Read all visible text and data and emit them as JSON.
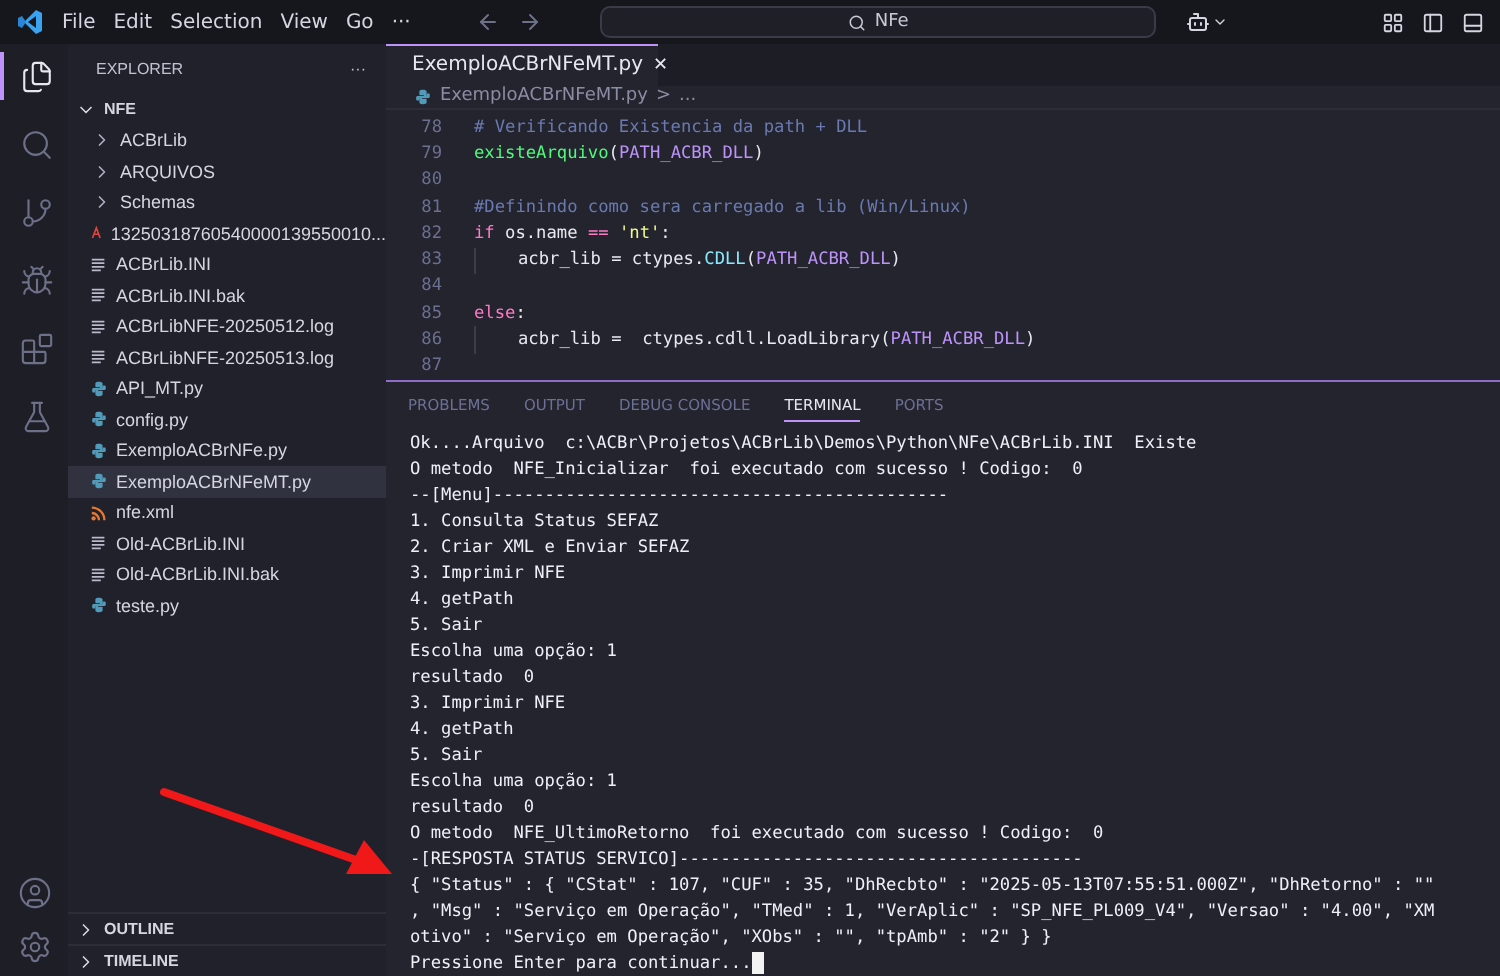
{
  "title_bar": {
    "menu": [
      "File",
      "Edit",
      "Selection",
      "View",
      "Go",
      "···"
    ],
    "search": "NFe"
  },
  "activity_bar": [
    {
      "kind": "explorer",
      "selected": true
    },
    {
      "kind": "search",
      "selected": false
    },
    {
      "kind": "source-control",
      "selected": false
    },
    {
      "kind": "run",
      "selected": false
    },
    {
      "kind": "extensions",
      "selected": false
    },
    {
      "kind": "testing",
      "selected": false
    }
  ],
  "sidebar": {
    "title": "EXPLORER",
    "more": "···",
    "folder": "NFE",
    "items": [
      {
        "name": "ACBrLib",
        "kind": "folder",
        "selected": false
      },
      {
        "name": "ARQUIVOS",
        "kind": "folder",
        "selected": false
      },
      {
        "name": "Schemas",
        "kind": "folder",
        "selected": false
      },
      {
        "name": "13250318760540000139550010...",
        "kind": "pdf",
        "selected": false
      },
      {
        "name": "ACBrLib.INI",
        "kind": "text",
        "selected": false
      },
      {
        "name": "ACBrLib.INI.bak",
        "kind": "text",
        "selected": false
      },
      {
        "name": "ACBrLibNFE-20250512.log",
        "kind": "text",
        "selected": false
      },
      {
        "name": "ACBrLibNFE-20250513.log",
        "kind": "text",
        "selected": false
      },
      {
        "name": "API_MT.py",
        "kind": "python",
        "selected": false
      },
      {
        "name": "config.py",
        "kind": "python",
        "selected": false
      },
      {
        "name": "ExemploACBrNFe.py",
        "kind": "python",
        "selected": false
      },
      {
        "name": "ExemploACBrNFeMT.py",
        "kind": "python",
        "selected": true
      },
      {
        "name": "nfe.xml",
        "kind": "xml",
        "selected": false
      },
      {
        "name": "Old-ACBrLib.INI",
        "kind": "text",
        "selected": false
      },
      {
        "name": "Old-ACBrLib.INI.bak",
        "kind": "text",
        "selected": false
      },
      {
        "name": "teste.py",
        "kind": "python",
        "selected": false
      }
    ],
    "sections": [
      "OUTLINE",
      "TIMELINE"
    ]
  },
  "editor": {
    "tab": {
      "label": "ExemploACBrNFeMT.py",
      "close": "✕"
    },
    "breadcrumb": [
      "ExemploACBrNFeMT.py",
      ">",
      "..."
    ],
    "lines": [
      {
        "number": "78",
        "tokens": [
          {
            "text": "# Verificando Existencia da path + DLL",
            "kind": "comment"
          }
        ]
      },
      {
        "number": "79",
        "tokens": [
          {
            "text": "existeArquivo",
            "kind": "function"
          },
          {
            "text": "(",
            "kind": "plain"
          },
          {
            "text": "PATH_ACBR_DLL",
            "kind": "param"
          },
          {
            "text": ")",
            "kind": "plain"
          }
        ]
      },
      {
        "number": "80"
      },
      {
        "number": "81",
        "tokens": [
          {
            "text": "#Definindo como sera carregado a lib (Win/Linux)",
            "kind": "comment"
          }
        ]
      },
      {
        "number": "82",
        "tokens": [
          {
            "text": "if",
            "kind": "keyword"
          },
          {
            "text": " os.name ",
            "kind": "plain"
          },
          {
            "text": "==",
            "kind": "keyword"
          },
          {
            "text": " 'nt'",
            "kind": "string"
          },
          {
            "text": ":",
            "kind": "plain"
          }
        ]
      },
      {
        "number": "83",
        "indented": true,
        "tokens": [
          {
            "text": "acbr_lib = ctypes.",
            "kind": "plain"
          },
          {
            "text": "CDLL",
            "kind": "class"
          },
          {
            "text": "(",
            "kind": "plain"
          },
          {
            "text": "PATH_ACBR_DLL",
            "kind": "param"
          },
          {
            "text": ")",
            "kind": "plain"
          }
        ]
      },
      {
        "number": "84"
      },
      {
        "number": "85",
        "tokens": [
          {
            "text": "else",
            "kind": "keyword"
          },
          {
            "text": ":",
            "kind": "plain"
          }
        ]
      },
      {
        "number": "86",
        "indented": true,
        "tokens": [
          {
            "text": "acbr_lib =  ctypes.cdll.LoadLibrary(",
            "kind": "plain"
          },
          {
            "text": "PATH_ACBR_DLL",
            "kind": "param"
          },
          {
            "text": ")",
            "kind": "plain"
          }
        ]
      },
      {
        "number": "87"
      }
    ]
  },
  "panel": {
    "tabs": [
      {
        "label": "PROBLEMS",
        "selected": false
      },
      {
        "label": "OUTPUT",
        "selected": false
      },
      {
        "label": "DEBUG CONSOLE",
        "selected": false
      },
      {
        "label": "TERMINAL",
        "selected": true
      },
      {
        "label": "PORTS",
        "selected": false
      }
    ],
    "terminal": [
      "Ok....Arquivo  c:\\ACBr\\Projetos\\ACBrLib\\Demos\\Python\\NFe\\ACBrLib.INI  Existe",
      "O metodo  NFE_Inicializar  foi executado com sucesso ! Codigo:  0",
      "--[Menu]--------------------------------------------",
      "1. Consulta Status SEFAZ",
      "2. Criar XML e Enviar SEFAZ",
      "3. Imprimir NFE",
      "4. getPath",
      "5. Sair",
      "Escolha uma opção: 1",
      "resultado  0",
      "3. Imprimir NFE",
      "4. getPath",
      "5. Sair",
      "Escolha uma opção: 1",
      "resultado  0",
      "O metodo  NFE_UltimoRetorno  foi executado com sucesso ! Codigo:  0",
      "-[RESPOSTA STATUS SERVICO]---------------------------------------",
      "{ \"Status\" : { \"CStat\" : 107, \"CUF\" : 35, \"DhRecbto\" : \"2025-05-13T07:55:51.000Z\", \"DhRetorno\" : \"\"",
      ", \"Msg\" : \"Serviço em Operação\", \"TMed\" : 1, \"VerAplic\" : \"SP_NFE_PL009_V4\", \"Versao\" : \"4.00\", \"XM",
      "otivo\" : \"Serviço em Operação\", \"XObs\" : \"\", \"tpAmb\" : \"2\" } }",
      "Pressione Enter para continuar..."
    ],
    "cursor": true
  },
  "annotation": {
    "kind": "arrow"
  }
}
